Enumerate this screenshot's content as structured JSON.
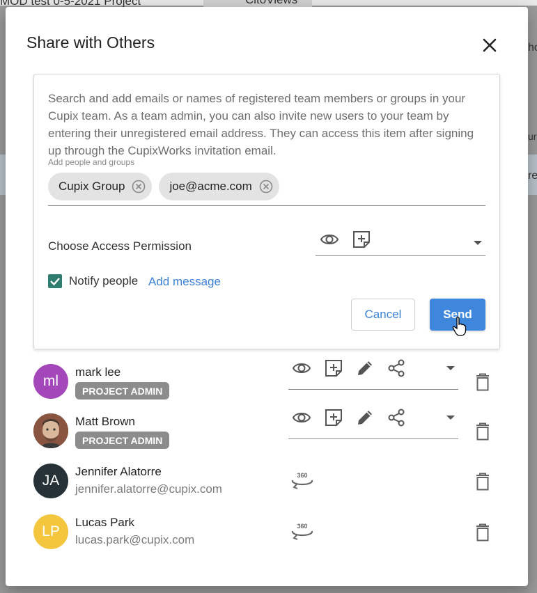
{
  "background": {
    "project_title": "MOD test 0-5-2021 Project",
    "tag_label": "CitoViews",
    "right_text_1": "ho",
    "right_text_2": "ur",
    "right_text_3": "re"
  },
  "dialog": {
    "title": "Share with Others",
    "help_text": "Search and add emails or names of registered team members or groups in your Cupix team. As a team admin, you can also invite new users to your team by entering their unregistered email address. They can access this item after signing up through the CupixWorks invitation email.",
    "field_label": "Add people and groups",
    "chips": [
      {
        "label": "Cupix Group"
      },
      {
        "label": "joe@acme.com"
      }
    ],
    "permission_label": "Choose Access Permission",
    "notify_label": "Notify people",
    "add_message": "Add message",
    "cancel": "Cancel",
    "send": "Send"
  },
  "members": [
    {
      "initials": "ml",
      "name": "mark lee",
      "role": "PROJECT ADMIN",
      "avatar_color": "#a347ba"
    },
    {
      "initials": "",
      "name": "Matt Brown",
      "role": "PROJECT ADMIN",
      "avatar_color": "#6d5a4e"
    },
    {
      "initials": "JA",
      "name": "Jennifer Alatorre",
      "email": "jennifer.alatorre@cupix.com",
      "avatar_color": "#263238"
    },
    {
      "initials": "LP",
      "name": "Lucas Park",
      "email": "lucas.park@cupix.com",
      "avatar_color": "#f4c63d"
    }
  ],
  "icons": {
    "view": "eye-icon",
    "annotate": "add-note-icon",
    "edit": "pencil-icon",
    "share": "share-icon",
    "delete": "trash-icon",
    "viewer_360": "360-icon",
    "close": "close-icon"
  },
  "colors": {
    "accent": "#3f87dd",
    "link": "#3b82d6",
    "checkbox": "#2e7d70",
    "badge": "#8c8c8c"
  }
}
